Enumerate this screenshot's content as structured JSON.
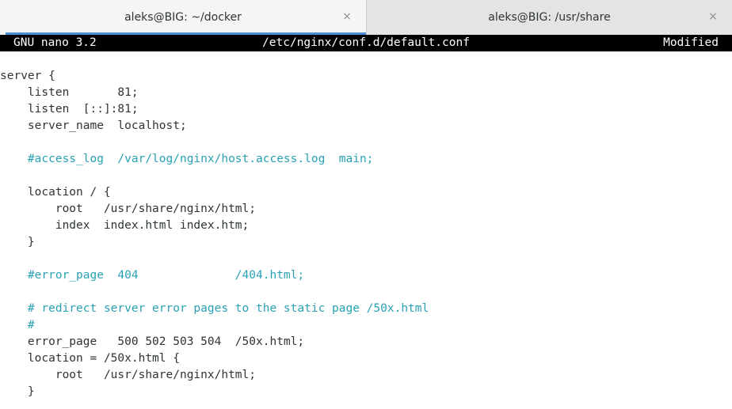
{
  "tabs": [
    {
      "title": "aleks@BIG: ~/docker",
      "active": true
    },
    {
      "title": "aleks@BIG: /usr/share",
      "active": false
    }
  ],
  "tab_close_glyph": "×",
  "nano": {
    "version": "GNU nano 3.2",
    "filename": "/etc/nginx/conf.d/default.conf",
    "status": "Modified"
  },
  "editor": {
    "lines": [
      {
        "text": "server {",
        "comment": false
      },
      {
        "text": "    listen       81;",
        "comment": false
      },
      {
        "text": "    listen  [::]:81;",
        "comment": false
      },
      {
        "text": "    server_name  localhost;",
        "comment": false
      },
      {
        "text": "",
        "comment": false
      },
      {
        "text": "    #access_log  /var/log/nginx/host.access.log  main;",
        "comment": true
      },
      {
        "text": "",
        "comment": false
      },
      {
        "text": "    location / {",
        "comment": false
      },
      {
        "text": "        root   /usr/share/nginx/html;",
        "comment": false
      },
      {
        "text": "        index  index.html index.htm;",
        "comment": false
      },
      {
        "text": "    }",
        "comment": false
      },
      {
        "text": "",
        "comment": false
      },
      {
        "text": "    #error_page  404              /404.html;",
        "comment": true
      },
      {
        "text": "",
        "comment": false
      },
      {
        "text": "    # redirect server error pages to the static page /50x.html",
        "comment": true
      },
      {
        "text": "    #",
        "comment": true
      },
      {
        "text": "    error_page   500 502 503 504  /50x.html;",
        "comment": false
      },
      {
        "text": "    location = /50x.html {",
        "comment": false
      },
      {
        "text": "        root   /usr/share/nginx/html;",
        "comment": false
      },
      {
        "text": "    }",
        "comment": false
      }
    ]
  },
  "colors": {
    "comment": "#2aa1b3",
    "text": "#2e3436",
    "tab_accent": "#4a90d9",
    "titlebar": "#000000"
  }
}
